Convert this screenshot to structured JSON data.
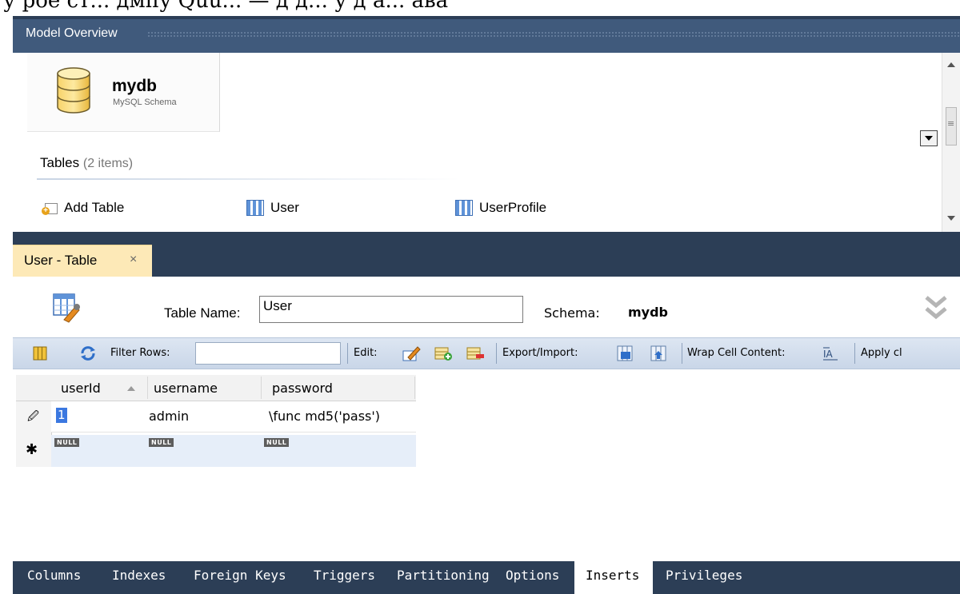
{
  "model_overview": {
    "title": "Model Overview",
    "schema_name": "mydb",
    "schema_type": "MySQL Schema",
    "tables_label": "Tables",
    "tables_count": "(2 items)",
    "items": [
      {
        "label": "Add Table",
        "icon": "add-table-icon"
      },
      {
        "label": "User",
        "icon": "table-icon"
      },
      {
        "label": "UserProfile",
        "icon": "table-icon"
      }
    ]
  },
  "editor_tab": {
    "label": "User - Table",
    "close": "×"
  },
  "editor": {
    "table_name_label": "Table Name:",
    "table_name_value": "User",
    "schema_label": "Schema:",
    "schema_value": "mydb"
  },
  "toolbar": {
    "filter_label": "Filter Rows:",
    "edit_label": "Edit:",
    "export_label": "Export/Import:",
    "wrap_label": "Wrap Cell Content:",
    "apply_label": "Apply cl"
  },
  "grid": {
    "columns": [
      "userId",
      "username",
      "password"
    ],
    "rows": [
      [
        "1",
        "admin",
        "\\func md5('pass')"
      ],
      [
        "NULL",
        "NULL",
        "NULL"
      ]
    ],
    "row_markers": [
      "🖉",
      "✱"
    ]
  },
  "bottom_tabs": [
    "Columns",
    "Indexes",
    "Foreign Keys",
    "Triggers",
    "Partitioning",
    "Options",
    "Inserts",
    "Privileges"
  ],
  "colors": {
    "frame": "#2c3e56",
    "header": "#405a7c",
    "tab_active": "#fde9b7",
    "toolbar": "#cfdbea"
  }
}
